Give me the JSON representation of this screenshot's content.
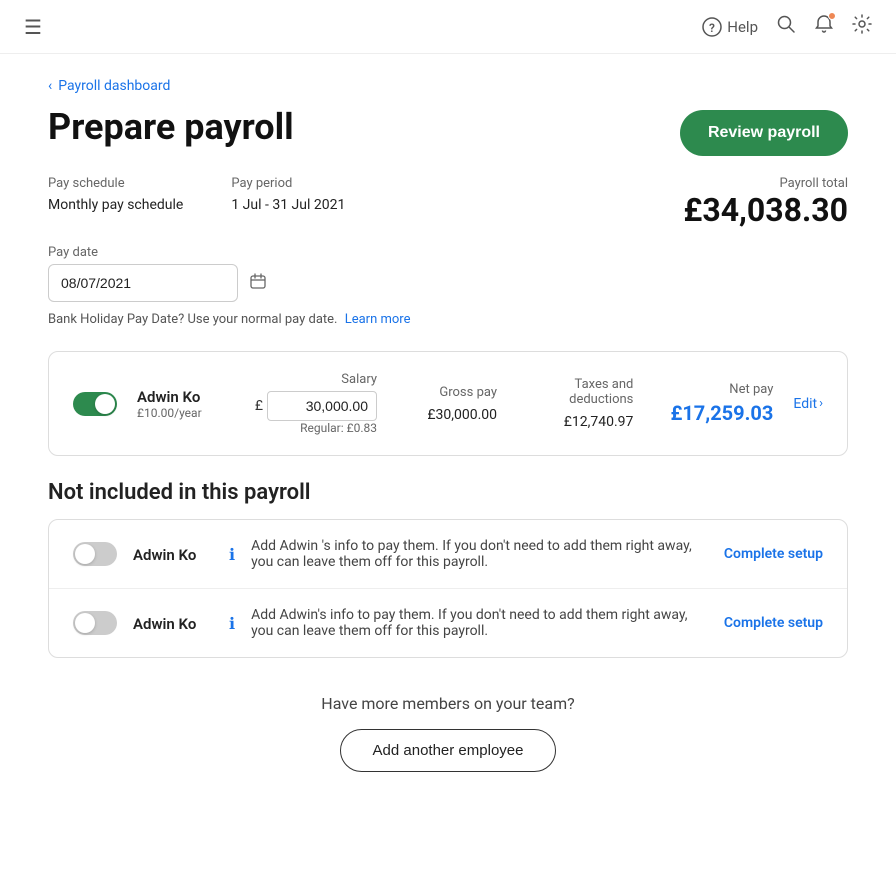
{
  "header": {
    "help_label": "Help",
    "hamburger_icon": "☰"
  },
  "breadcrumb": {
    "back_arrow": "‹",
    "link_text": "Payroll dashboard"
  },
  "page": {
    "title": "Prepare payroll",
    "review_btn": "Review payroll"
  },
  "pay_info": {
    "schedule_label": "Pay schedule",
    "schedule_value": "Monthly pay schedule",
    "period_label": "Pay period",
    "period_value": "1 Jul - 31 Jul 2021",
    "date_label": "Pay date",
    "date_value": "08/07/2021",
    "date_placeholder": "08/07/2021",
    "total_label": "Payroll total",
    "total_value": "£34,038.30"
  },
  "bank_holiday_note": "Bank Holiday Pay Date? Use your normal pay date.",
  "learn_more_link": "Learn more",
  "employee": {
    "name": "Adwin Ko",
    "rate": "£10.00/year",
    "salary_label": "Salary",
    "salary_currency": "£",
    "salary_value": "30,000.00",
    "salary_regular": "Regular: £0.83",
    "gross_pay_label": "Gross pay",
    "gross_pay_value": "£30,000.00",
    "taxes_label": "Taxes and deductions",
    "taxes_value": "£12,740.97",
    "net_pay_label": "Net pay",
    "net_pay_value": "£17,259.03",
    "edit_label": "Edit"
  },
  "not_included": {
    "section_title": "Not included in this payroll",
    "employees": [
      {
        "name": "Adwin Ko",
        "message": "Add Adwin 's info to pay them. If you don't need to add them right away, you can leave them off for this payroll.",
        "cta": "Complete setup"
      },
      {
        "name": "Adwin Ko",
        "message": "Add Adwin's info to pay them. If you don't need to add them right away, you can leave them off for this payroll.",
        "cta": "Complete setup"
      }
    ]
  },
  "bottom_cta": {
    "question": "Have more members on your team?",
    "button_label": "Add another employee"
  }
}
